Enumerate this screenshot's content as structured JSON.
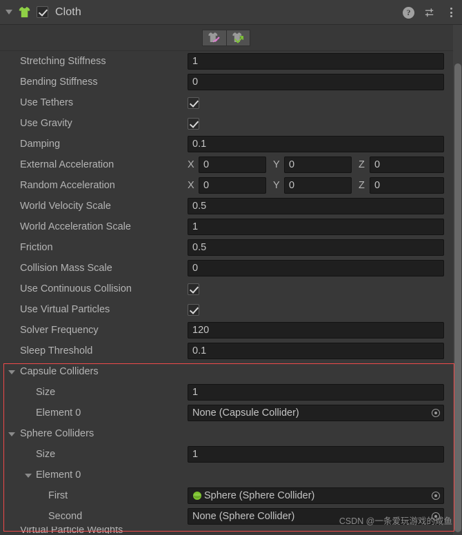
{
  "header": {
    "title": "Cloth",
    "enabled_checkbox": true,
    "component_icon": "cloth-shirt-icon",
    "help_icon": "?",
    "preset_icon": "preset-sliders-icon",
    "menu_icon": "kebab-menu-icon"
  },
  "toolbar": {
    "buttons": [
      {
        "name": "paint-constraints-tool",
        "icon": "shirt-pin-icon"
      },
      {
        "name": "self-collision-tool",
        "icon": "shirt-arrow-icon"
      }
    ]
  },
  "properties": [
    {
      "label": "Stretching Stiffness",
      "type": "number",
      "value": "1"
    },
    {
      "label": "Bending Stiffness",
      "type": "number",
      "value": "0"
    },
    {
      "label": "Use Tethers",
      "type": "bool",
      "value": true
    },
    {
      "label": "Use Gravity",
      "type": "bool",
      "value": true
    },
    {
      "label": "Damping",
      "type": "number",
      "value": "0.1"
    },
    {
      "label": "External Acceleration",
      "type": "vector3",
      "x": "0",
      "y": "0",
      "z": "0"
    },
    {
      "label": "Random Acceleration",
      "type": "vector3",
      "x": "0",
      "y": "0",
      "z": "0"
    },
    {
      "label": "World Velocity Scale",
      "type": "number",
      "value": "0.5"
    },
    {
      "label": "World Acceleration Scale",
      "type": "number",
      "value": "1"
    },
    {
      "label": "Friction",
      "type": "number",
      "value": "0.5"
    },
    {
      "label": "Collision Mass Scale",
      "type": "number",
      "value": "0"
    },
    {
      "label": "Use Continuous Collision",
      "type": "bool",
      "value": true
    },
    {
      "label": "Use Virtual Particles",
      "type": "bool",
      "value": true
    },
    {
      "label": "Solver Frequency",
      "type": "number",
      "value": "120"
    },
    {
      "label": "Sleep Threshold",
      "type": "number",
      "value": "0.1"
    }
  ],
  "axis_labels": {
    "x": "X",
    "y": "Y",
    "z": "Z"
  },
  "capsule_colliders": {
    "label": "Capsule Colliders",
    "expanded": true,
    "size_label": "Size",
    "size_value": "1",
    "element_label": "Element 0",
    "element_value": "None (Capsule Collider)"
  },
  "sphere_colliders": {
    "label": "Sphere Colliders",
    "expanded": true,
    "size_label": "Size",
    "size_value": "1",
    "element_label": "Element 0",
    "first_label": "First",
    "first_value": "Sphere (Sphere Collider)",
    "first_icon": "sphere-mesh-icon",
    "second_label": "Second",
    "second_value": "None (Sphere Collider)"
  },
  "clipped_bottom": {
    "label": "Virtual Particle Weights"
  },
  "watermark": {
    "text": "CSDN @一条爱玩游戏的咸鱼"
  },
  "colors": {
    "panel_bg": "#383838",
    "header_bg": "#3c3c3c",
    "field_bg": "#1f1f1f",
    "text": "#b4b4b4",
    "highlight_border": "#f04a4a",
    "accent_green": "#8fd146",
    "accent_pink": "#e07ad0"
  }
}
